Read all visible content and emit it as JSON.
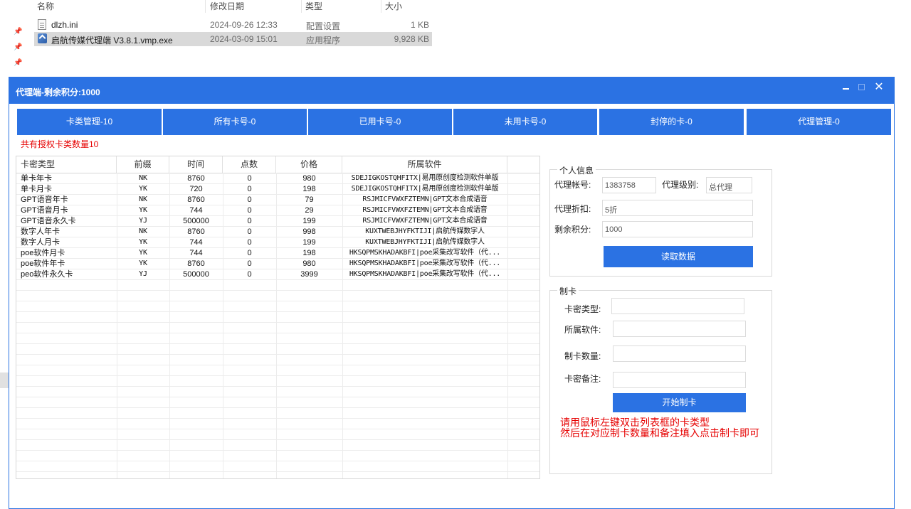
{
  "explorer": {
    "columns": {
      "name": "名称",
      "date": "修改日期",
      "type": "类型",
      "size": "大小"
    },
    "files": [
      {
        "name": "dlzh.ini",
        "date": "2024-09-26 12:33",
        "type": "配置设置",
        "size": "1 KB",
        "icon": "ini-file-icon"
      },
      {
        "name": "启航传媒代理端 V3.8.1.vmp.exe",
        "date": "2024-03-09 15:01",
        "type": "应用程序",
        "size": "9,928 KB",
        "icon": "exe-file-icon"
      }
    ]
  },
  "window": {
    "title": "代理端-剩余积分:1000",
    "controls": {
      "close": "✕"
    }
  },
  "tabs": [
    "卡类管理-10",
    "所有卡号-0",
    "已用卡号-0",
    "未用卡号-0",
    "封停的卡-0",
    "代理管理-0"
  ],
  "auth_note": "共有授权卡类数量10",
  "table": {
    "headers": [
      "卡密类型",
      "前缀",
      "时间",
      "点数",
      "价格",
      "所属软件"
    ],
    "rows": [
      [
        "单卡年卡",
        "NK",
        "8760",
        "0",
        "980",
        "SDEJIGKOSTQHFITX|易用原创度检测软件单版"
      ],
      [
        "单卡月卡",
        "YK",
        "720",
        "0",
        "198",
        "SDEJIGKOSTQHFITX|易用原创度检测软件单版"
      ],
      [
        "GPT语音年卡",
        "NK",
        "8760",
        "0",
        "79",
        "RSJMICFVWXFZTEMN|GPT文本合成语音"
      ],
      [
        "GPT语音月卡",
        "YK",
        "744",
        "0",
        "29",
        "RSJMICFVWXFZTEMN|GPT文本合成语音"
      ],
      [
        "GPT语音永久卡",
        "YJ",
        "500000",
        "0",
        "199",
        "RSJMICFVWXFZTEMN|GPT文本合成语音"
      ],
      [
        "数字人年卡",
        "NK",
        "8760",
        "0",
        "998",
        "KUXTWEBJHYFKTIJI|启航传媒数字人"
      ],
      [
        "数字人月卡",
        "YK",
        "744",
        "0",
        "199",
        "KUXTWEBJHYFKTIJI|启航传媒数字人"
      ],
      [
        "poe软件月卡",
        "YK",
        "744",
        "0",
        "198",
        "HKSQPMSKHADAKBFI|poe采集改写软件（代..."
      ],
      [
        "poe软件年卡",
        "YK",
        "8760",
        "0",
        "980",
        "HKSQPMSKHADAKBFI|poe采集改写软件（代..."
      ],
      [
        "peo软件永久卡",
        "YJ",
        "500000",
        "0",
        "3999",
        "HKSQPMSKHADAKBFI|poe采集改写软件（代..."
      ]
    ]
  },
  "personal": {
    "group_title": "个人信息",
    "account_label": "代理帐号:",
    "account_value": "1383758",
    "level_label": "代理级别:",
    "level_value": "总代理",
    "discount_label": "代理折扣:",
    "discount_value": "5折",
    "points_label": "剩余积分:",
    "points_value": "1000",
    "read_button": "读取数据"
  },
  "make_card": {
    "group_title": "制卡",
    "type_label": "卡密类型:",
    "type_value": "",
    "software_label": "所属软件:",
    "software_value": "",
    "count_label": "制卡数量:",
    "count_value": "",
    "note_label": "卡密备注:",
    "note_value": "",
    "start_button": "开始制卡",
    "hint_line1": "请用鼠标左键双击列表框的卡类型",
    "hint_line2": "然后在对应制卡数量和备注填入点击制卡即可"
  }
}
